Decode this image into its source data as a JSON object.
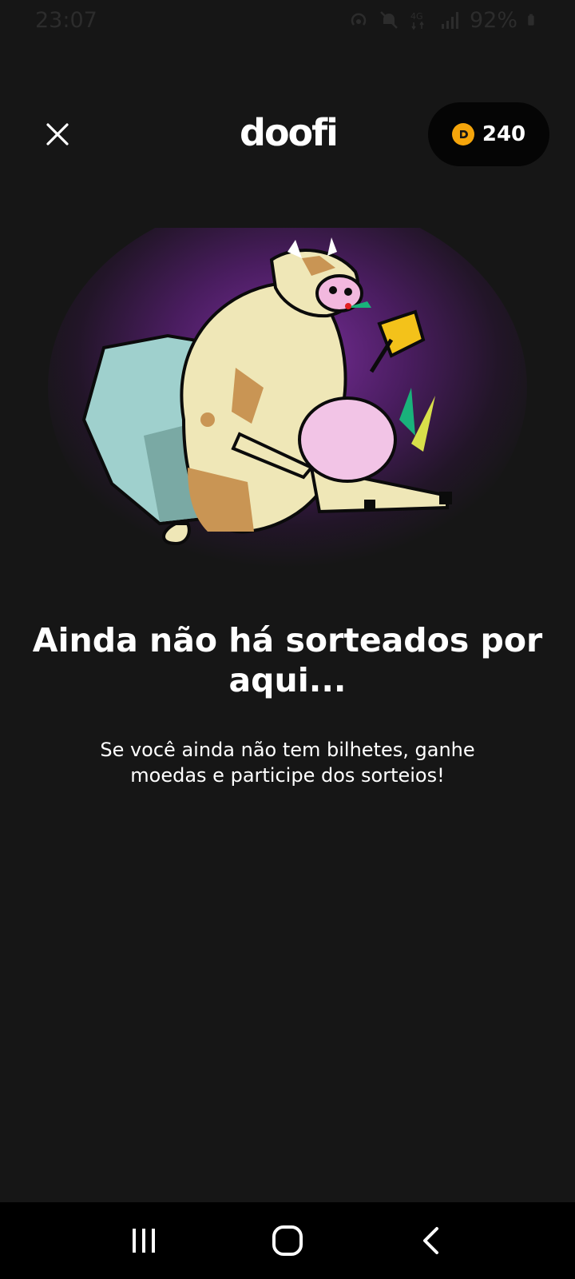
{
  "status_bar": {
    "time": "23:07",
    "battery": "92%",
    "icons": [
      "hotspot-icon",
      "mute-icon",
      "4g-icon",
      "signal-icon",
      "battery-icon"
    ]
  },
  "header": {
    "logo_text": "doofi",
    "coins": "240",
    "close_icon": "close-icon",
    "coin_icon": "coin-icon"
  },
  "empty_state": {
    "illustration": "cow-with-bell-illustration",
    "title": "Ainda não há sorteados por aqui...",
    "message": "Se você ainda não tem bilhetes, ganhe moedas e participe dos sorteios!"
  },
  "nav_bar": {
    "icons": [
      "recent-apps-icon",
      "home-icon",
      "back-icon"
    ]
  },
  "colors": {
    "background": "#161616",
    "coin": "#f5a50b",
    "glow": "#6a2a8a"
  }
}
